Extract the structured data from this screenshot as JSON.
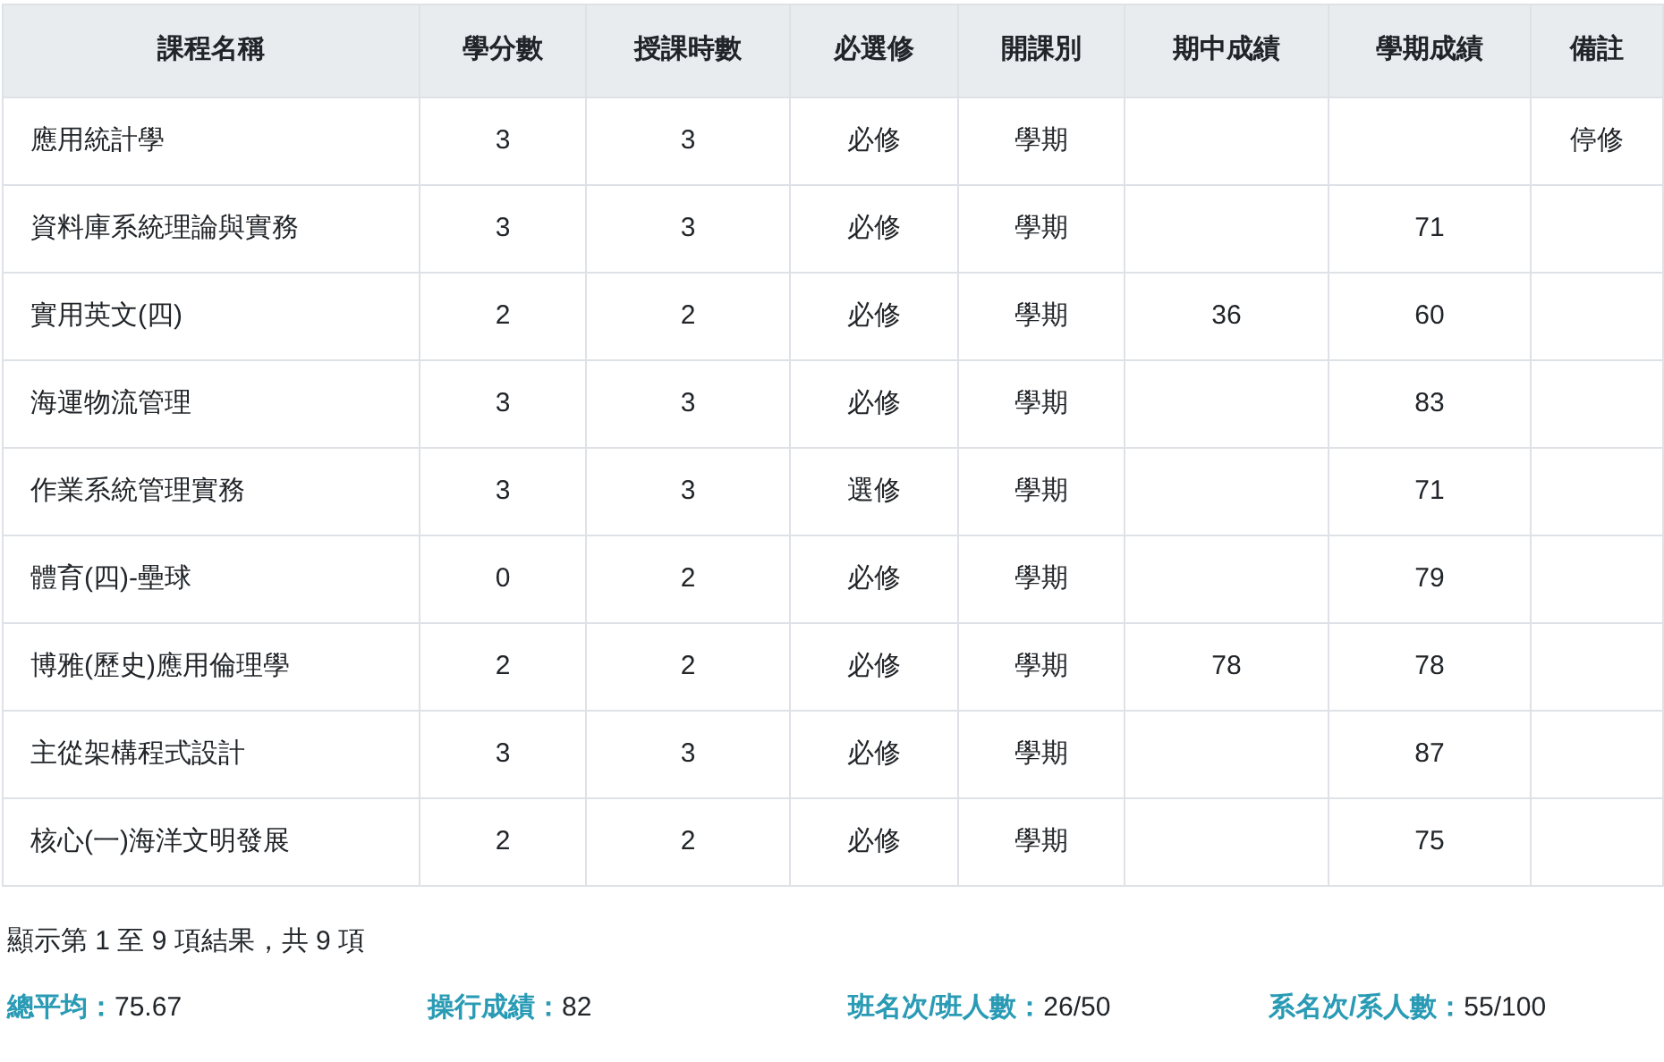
{
  "table": {
    "columns": [
      "課程名稱",
      "學分數",
      "授課時數",
      "必選修",
      "開課別",
      "期中成績",
      "學期成績",
      "備註"
    ],
    "rows": [
      [
        "應用統計學",
        "3",
        "3",
        "必修",
        "學期",
        null,
        null,
        "停修"
      ],
      [
        "資料庫系統理論與實務",
        "3",
        "3",
        "必修",
        "學期",
        null,
        "71",
        null
      ],
      [
        "實用英文(四)",
        "2",
        "2",
        "必修",
        "學期",
        "36",
        "60",
        null
      ],
      [
        "海運物流管理",
        "3",
        "3",
        "必修",
        "學期",
        null,
        "83",
        null
      ],
      [
        "作業系統管理實務",
        "3",
        "3",
        "選修",
        "學期",
        null,
        "71",
        null
      ],
      [
        "體育(四)-壘球",
        "0",
        "2",
        "必修",
        "學期",
        null,
        "79",
        null
      ],
      [
        "博雅(歷史)應用倫理學",
        "2",
        "2",
        "必修",
        "學期",
        "78",
        "78",
        null
      ],
      [
        "主從架構程式設計",
        "3",
        "3",
        "必修",
        "學期",
        null,
        "87",
        null
      ],
      [
        "核心(一)海洋文明發展",
        "2",
        "2",
        "必修",
        "學期",
        null,
        "75",
        null
      ]
    ]
  },
  "table_info": "顯示第 1 至 9 項結果，共 9 項",
  "summary": [
    {
      "label": "總平均：",
      "value": "75.67"
    },
    {
      "label": "操行成績：",
      "value": "82"
    },
    {
      "label": "班名次/班人數：",
      "value": "26/50"
    },
    {
      "label": "系名次/系人數：",
      "value": "55/100"
    }
  ]
}
